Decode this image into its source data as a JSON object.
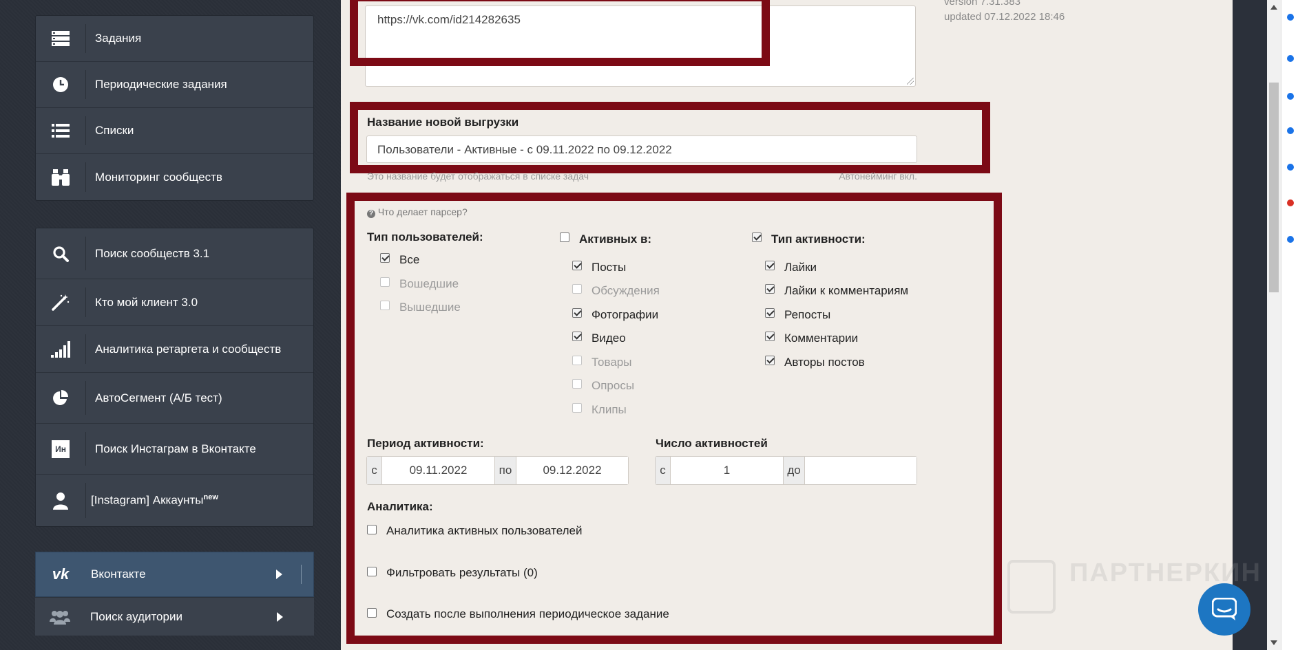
{
  "sidebar": {
    "group1": [
      {
        "label": "Задания",
        "icon": "tasks-icon"
      },
      {
        "label": "Периодические задания",
        "icon": "clock-icon"
      },
      {
        "label": "Списки",
        "icon": "list-icon"
      },
      {
        "label": "Мониторинг сообществ",
        "icon": "binoculars-icon"
      }
    ],
    "group2": [
      {
        "label": "Поиск сообществ 3.1",
        "icon": "search-icon"
      },
      {
        "label": "Кто мой клиент 3.0",
        "icon": "magic-wand-icon"
      },
      {
        "label": "Аналитика ретаргета и сообществ",
        "icon": "signal-bars-icon"
      },
      {
        "label": "АвтоСегмент (А/Б тест)",
        "icon": "pie-chart-icon"
      },
      {
        "label": "Поиск Инстаграм в Вконтакте",
        "icon": "instagram-vk-icon"
      },
      {
        "label": "[Instagram] Аккаунты",
        "sup": "new",
        "icon": "user-icon"
      }
    ],
    "vk": {
      "label": "Вконтакте",
      "icon": "vk-icon"
    },
    "audience": {
      "label": "Поиск аудитории",
      "icon": "users-icon"
    },
    "ins_icon_text": "Ин"
  },
  "main": {
    "url_value": "https://vk.com/id214282635",
    "version_line1": "version 7.31.383",
    "version_line2": "updated 07.12.2022 18:46",
    "export_name_label": "Название новой выгрузки",
    "export_name_value": "Пользователи - Активные - с 09.11.2022 по 09.12.2022",
    "export_name_hint": "Это название будет отображаться в списке задач",
    "autonaming": "Автонейминг вкл.",
    "parser_help": "Что делает парсер?",
    "user_type": {
      "title": "Тип пользователей:",
      "options": [
        {
          "label": "Все",
          "checked": true,
          "disabled": false
        },
        {
          "label": "Вошедшие",
          "checked": false,
          "disabled": true
        },
        {
          "label": "Вышедшие",
          "checked": false,
          "disabled": true
        }
      ]
    },
    "active_in": {
      "title": "Активных в:",
      "checked": false,
      "options": [
        {
          "label": "Посты",
          "checked": true,
          "disabled": false
        },
        {
          "label": "Обсуждения",
          "checked": false,
          "disabled": true
        },
        {
          "label": "Фотографии",
          "checked": true,
          "disabled": false
        },
        {
          "label": "Видео",
          "checked": true,
          "disabled": false
        },
        {
          "label": "Товары",
          "checked": false,
          "disabled": true
        },
        {
          "label": "Опросы",
          "checked": false,
          "disabled": true
        },
        {
          "label": "Клипы",
          "checked": false,
          "disabled": true
        }
      ]
    },
    "activity_type": {
      "title": "Тип активности:",
      "checked": true,
      "options": [
        {
          "label": "Лайки",
          "checked": true,
          "disabled": false
        },
        {
          "label": "Лайки к комментариям",
          "checked": true,
          "disabled": false
        },
        {
          "label": "Репосты",
          "checked": true,
          "disabled": false
        },
        {
          "label": "Комментарии",
          "checked": true,
          "disabled": false
        },
        {
          "label": "Авторы постов",
          "checked": true,
          "disabled": false
        }
      ]
    },
    "period": {
      "label": "Период активности:",
      "from_prefix": "с",
      "from_value": "09.11.2022",
      "to_prefix": "по",
      "to_value": "09.12.2022"
    },
    "count": {
      "label": "Число активностей",
      "from_prefix": "с",
      "from_value": "1",
      "to_prefix": "до",
      "to_value": ""
    },
    "analytics": {
      "title": "Аналитика:",
      "active_users": "Аналитика активных пользователей",
      "filter": "Фильтровать результаты (0)",
      "create_periodic": "Создать после выполнения периодическое задание"
    },
    "watermark": "ПАРТНЕРКИН"
  },
  "colors": {
    "highlight": "#7c0a15",
    "vk_active": "#3e5670",
    "chat": "#1d76c2"
  }
}
